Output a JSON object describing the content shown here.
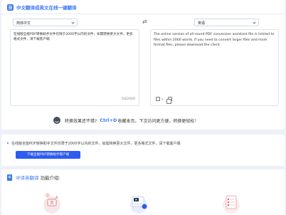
{
  "header": {
    "title": "中文翻译成英文在线一键翻译"
  },
  "source_lang": {
    "value": "简体中文"
  },
  "target_lang": {
    "value": "英语"
  },
  "source": {
    "text": "在线版全能PDF转换助手文件仅限于2000字以内的文件，如需转换更大文件，更多格式文件，请下载客户端",
    "counter": "50/2000"
  },
  "target": {
    "text": "The online version of all-round PDF conversion assistant file is limited to files within 2000 words. If you need to convert larger files and more format files, please download the client"
  },
  "tip": {
    "before": "转换效果还不错?",
    "shortcut": "Ctrl+D",
    "after": "收藏本页，下次访问更方便，转换更轻松！"
  },
  "notice": {
    "text": "在线版全能PDF转换助手文件仅限于2000字以内的文件，如需转换更大文件，更多格式文件，请下载客户端",
    "button": "下载全能PDF转换助手客户端"
  },
  "intro": {
    "accent": "中译英翻译",
    "rest": "功能介绍:"
  },
  "colors": {
    "accent": "#3b78f7",
    "button": "#2e5bf0",
    "background": "#eef1f7"
  },
  "icons": [
    "translate-icon",
    "swap-icon",
    "chevron-down-icon",
    "speaker-icon",
    "copy-icon",
    "smile-icon",
    "document-icon"
  ]
}
